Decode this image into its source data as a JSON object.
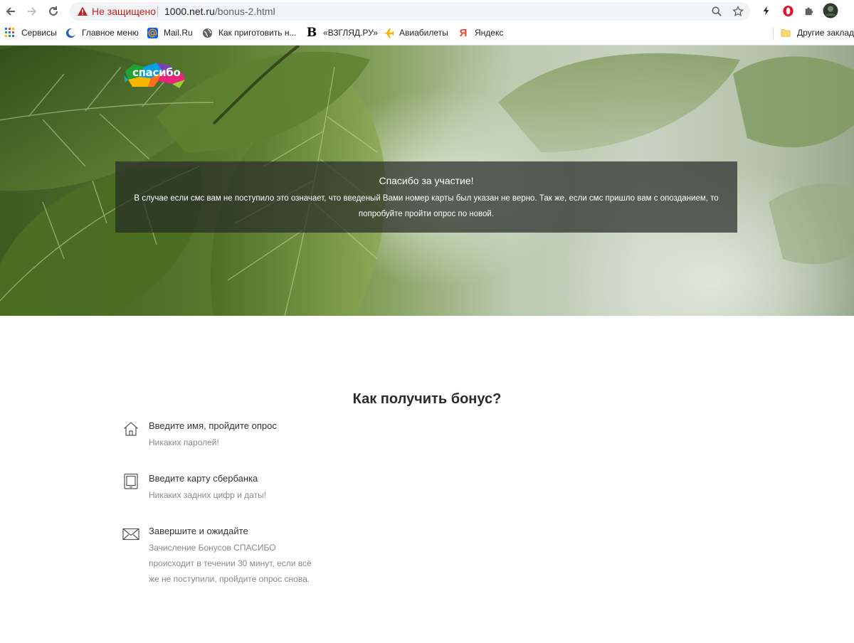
{
  "browser": {
    "security_label": "Не защищено",
    "url_host": "1000.net.ru",
    "url_path": "/bonus-2.html",
    "bookmarks": [
      {
        "label": "Сервисы",
        "icon": "apps-grid-icon"
      },
      {
        "label": "Главное меню",
        "icon": "crescent-icon"
      },
      {
        "label": "Mail.Ru",
        "icon": "mail-at-icon"
      },
      {
        "label": "Как приготовить н...",
        "icon": "globe-icon"
      },
      {
        "label": "«ВЗГЛЯД.РУ»",
        "icon": "vzglyad-b-icon"
      },
      {
        "label": "Авиабилеты",
        "icon": "airplane-icon"
      },
      {
        "label": "Яндекс",
        "icon": "yandex-icon"
      }
    ],
    "other_bookmarks": "Другие закладк"
  },
  "hero": {
    "logo_text": "спасибо",
    "notice_title": "Спасибо за участие!",
    "notice_body": "В случае если смс вам не поступило это означает, что введеный Вами номер карты был указан не верно. Так же, если смс пришло вам с опозданием, то попробуйте пройти опрос по новой."
  },
  "how": {
    "title": "Как получить бонус?",
    "steps": [
      {
        "icon": "house-icon",
        "title": "Введите имя, пройдите опрос",
        "desc": "Никаких паролей!"
      },
      {
        "icon": "tablet-icon",
        "title": "Введите карту сбербанка",
        "desc": "Никаких задних цифр и даты!"
      },
      {
        "icon": "envelope-icon",
        "title": "Завершите и ожидайте",
        "desc": "Зачисление Бонусов СПАСИБО происходит в течении 30 минут, если всё же не поступили, пройдите опрос снова."
      }
    ]
  },
  "colors": {
    "insecure_red": "#c5221f",
    "notice_bg": "#282c28",
    "brand_green": "#21a038"
  }
}
